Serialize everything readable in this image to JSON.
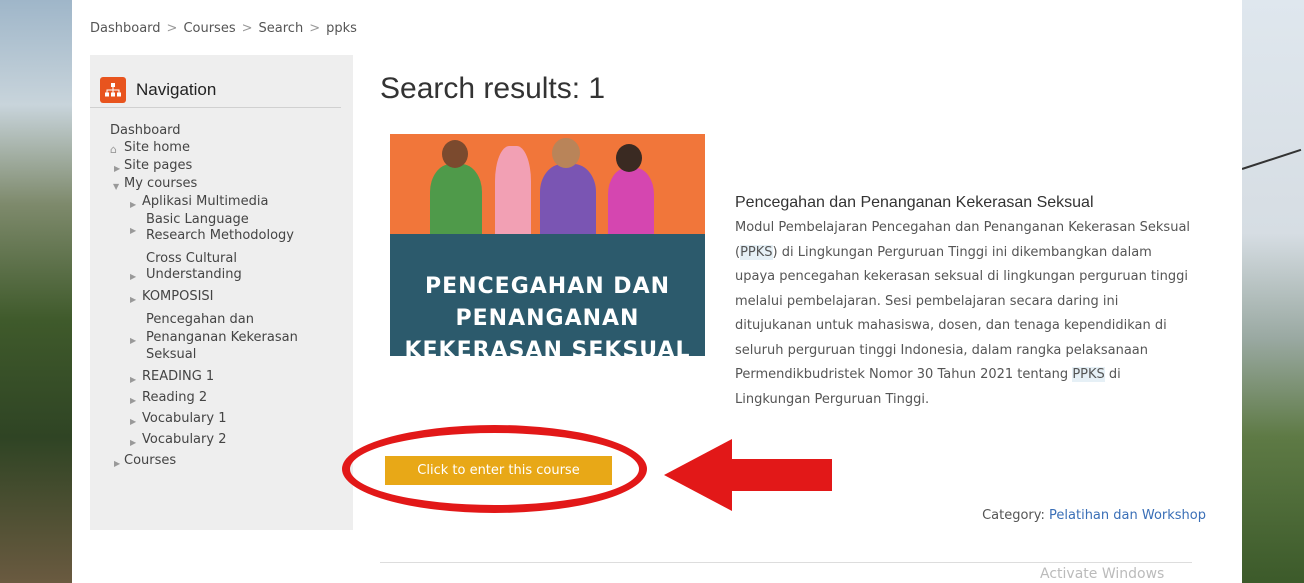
{
  "breadcrumb": {
    "items": [
      "Dashboard",
      "Courses",
      "Search",
      "ppks"
    ],
    "separator": ">"
  },
  "navigation": {
    "title": "Navigation",
    "icon": "sitemap-icon",
    "items": {
      "dashboard": "Dashboard",
      "site_home": "Site home",
      "site_pages": "Site pages",
      "my_courses": "My courses",
      "aplikasi": "Aplikasi Multimedia",
      "basic_1": "Basic Language",
      "basic_2": "Research Methodology",
      "cross_1": "Cross Cultural",
      "cross_2": "Understanding",
      "komposisi": "KOMPOSISI",
      "ppks_1": "Pencegahan dan",
      "ppks_2": "Penanganan Kekerasan",
      "ppks_3": "Seksual",
      "reading1": "READING 1",
      "reading2": "Reading 2",
      "vocab1": "Vocabulary 1",
      "vocab2": "Vocabulary 2",
      "courses": "Courses"
    }
  },
  "main": {
    "title": "Search results: 1",
    "course": {
      "image_text_1": "PENCEGAHAN DAN",
      "image_text_2": "PENANGANAN",
      "image_text_3": "KEKERASAN SEKSUAL",
      "name": "Pencegahan dan Penanganan Kekerasan Seksual",
      "summary_1": "Modul Pembelajaran Pencegahan dan Penanganan Kekerasan Seksual (",
      "summary_hl1": "PPKS",
      "summary_2": ") di Lingkungan Perguruan Tinggi ini dikembangkan dalam upaya pencegahan kekerasan seksual di lingkungan perguruan tinggi melalui pembelajaran. Sesi pembelajaran secara daring ini ditujukanan untuk mahasiswa, dosen, dan tenaga kependidikan di seluruh perguruan tinggi Indonesia, dalam rangka pelaksanaan Permendikbudristek Nomor 30 Tahun 2021 tentang ",
      "summary_hl2": "PPKS",
      "summary_3": " di Lingkungan Perguruan Tinggi.",
      "enter_label": "Click to enter this course",
      "category_label": "Category:",
      "category_value": "Pelatihan dan Workshop"
    },
    "watermark": "Activate Windows"
  },
  "colors": {
    "button": "#e8a817",
    "annotation": "#e21818",
    "nav_icon": "#e8541e",
    "link": "#3a6fb7"
  }
}
